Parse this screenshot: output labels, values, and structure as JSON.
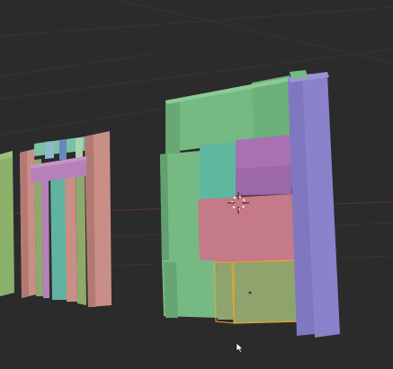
{
  "viewport": {
    "background": "#2b2b2c",
    "grid_line_color": "#3a3a3b",
    "axis_x_color": "#6b3a40",
    "cursor_icon": "3d-cursor-icon",
    "mouse_pointer_icon": "mouse-pointer-icon"
  },
  "objects": {
    "left_edge_panel": {
      "color": "#8ab06a"
    },
    "door_frame": {
      "colors": [
        "#c98f86",
        "#7bb38b",
        "#8fa86d",
        "#b581b8",
        "#7cc1a4"
      ]
    },
    "wall_panel": {
      "colors": [
        "#77b983",
        "#5eb89f",
        "#a872b2",
        "#c47a88",
        "#8fa36c",
        "#7f78c1"
      ]
    },
    "selected_piece": {
      "outline_color": "#f0a030"
    }
  }
}
